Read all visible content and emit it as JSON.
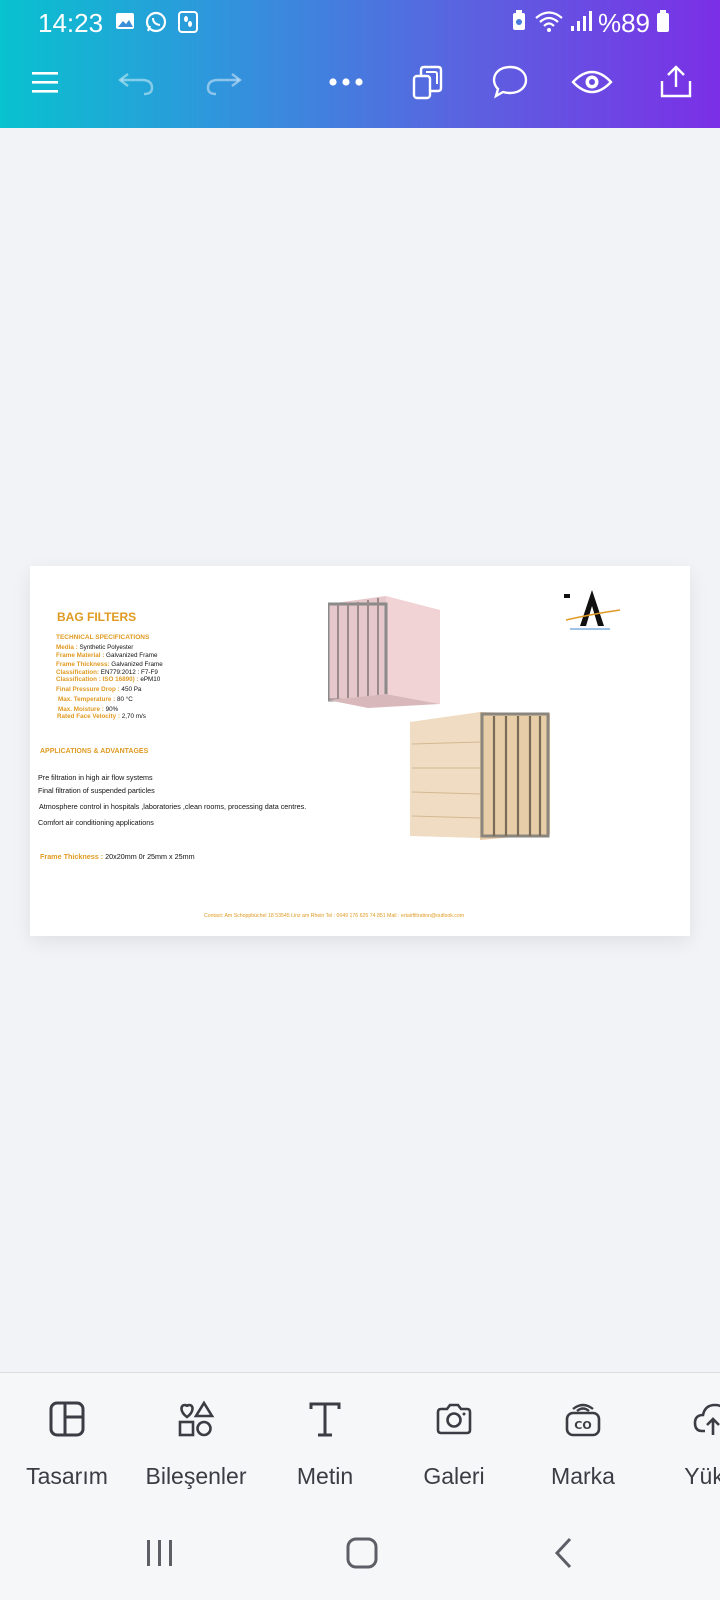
{
  "status_bar": {
    "time": "14:23",
    "battery_percent": "%89",
    "icons_left": [
      "gallery-icon",
      "whatsapp-icon",
      "steps-icon"
    ],
    "icons_right": [
      "battery-saver-icon",
      "wifi-icon",
      "signal-icon",
      "battery-icon"
    ]
  },
  "toolbar": {
    "icons": [
      "menu-icon",
      "undo-icon",
      "redo-icon",
      "more-icon",
      "pages-icon",
      "comment-icon",
      "preview-icon",
      "share-icon"
    ]
  },
  "document": {
    "title": "BAG FILTERS",
    "section_title": "TECHNICAL SPECIFICATIONS",
    "specs": [
      {
        "key": "Media :",
        "value": " Synthetic Polyester"
      },
      {
        "key": "Frame Material :",
        "value": " Galvanized Frame"
      },
      {
        "key": "Frame Thickness:",
        "value": " Galvanized Frame"
      },
      {
        "key": "Classification:",
        "value": " EN779:2012 : F7-F9"
      },
      {
        "key": "Classification : ISO 16890) :",
        "value": " ePM10"
      },
      {
        "key": "Final Pressure Drop :",
        "value": " 450 Pa"
      },
      {
        "key": "Max. Temperature :",
        "value": " 80 °C"
      },
      {
        "key": "Max. Moisture :",
        "value": " 90%"
      },
      {
        "key": "Rated Face Velocity :",
        "value": " 2,70 m/s"
      }
    ],
    "applications_title": "APPLICATIONS & ADVANTAGES",
    "applications": [
      "Pre filtration in high air flow systems",
      "Final filtration of suspended particles",
      "Atmosphere control in hospitals ,laboratories ,clean rooms, processing data centres.",
      "Comfort air conditioning applications"
    ],
    "frame_thickness_key": "Frame Thickness :",
    "frame_thickness_value": " 20x20mm  0r 25mm x 25mm",
    "contact": "Contact: Am Schoppbüchel 18 53545 Linz am Rhein    Tel : 0049 176 625 74 851  Mail : ertairfiltration@outlook.com"
  },
  "bottom_tools": [
    {
      "label": "Tasarım",
      "icon": "design-icon"
    },
    {
      "label": "Bileşenler",
      "icon": "elements-icon"
    },
    {
      "label": "Metin",
      "icon": "text-icon"
    },
    {
      "label": "Galeri",
      "icon": "camera-icon"
    },
    {
      "label": "Marka",
      "icon": "brand-icon"
    },
    {
      "label": "Yükle",
      "icon": "upload-icon"
    }
  ],
  "nav": {
    "icons": [
      "recents-icon",
      "home-icon",
      "back-icon"
    ]
  }
}
